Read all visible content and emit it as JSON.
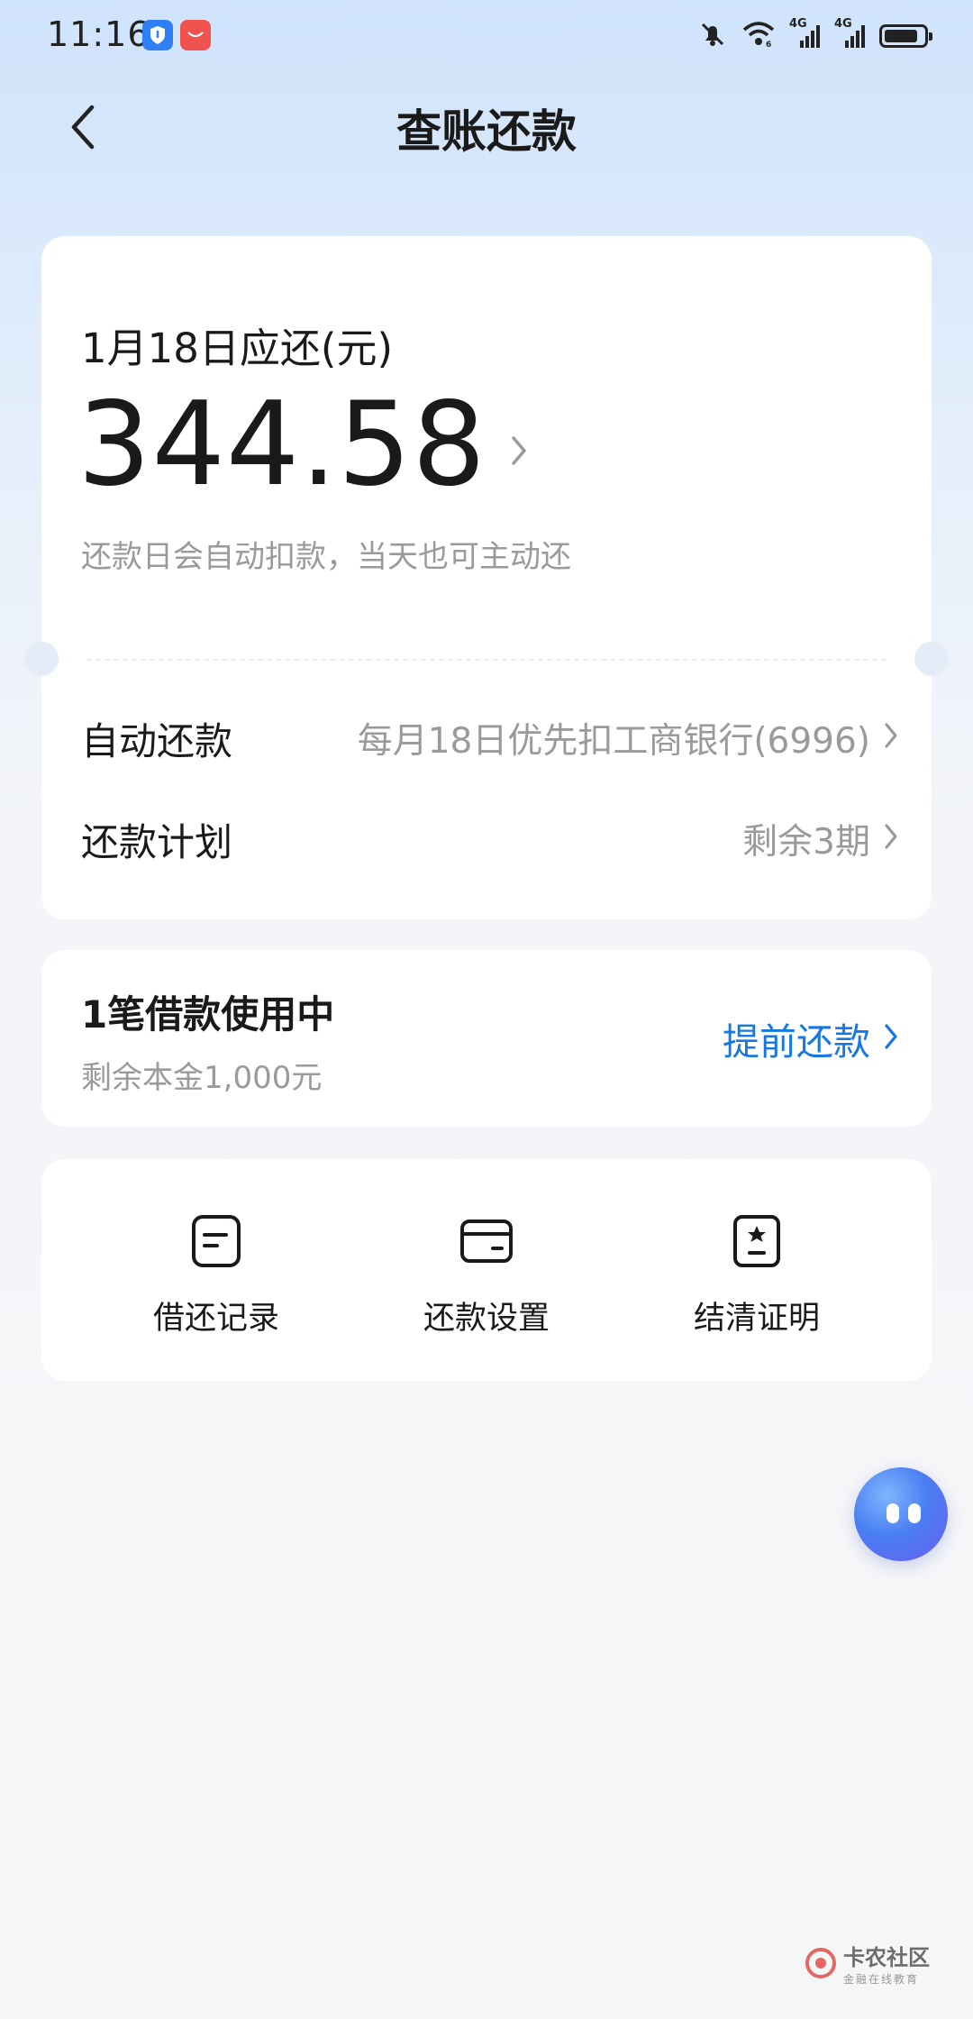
{
  "status_bar": {
    "time": "11:16",
    "network_1": "4G",
    "network_2": "4G",
    "battery_level": 0.85
  },
  "header": {
    "title": "查账还款"
  },
  "bill": {
    "due_label": "1月18日应还(元)",
    "amount": "344.58",
    "note": "还款日会自动扣款，当天也可主动还"
  },
  "auto_repay": {
    "label": "自动还款",
    "value": "每月18日优先扣工商银行(6996)"
  },
  "repay_plan": {
    "label": "还款计划",
    "value": "剩余3期"
  },
  "loan": {
    "title": "1笔借款使用中",
    "remaining": "剩余本金1,000元",
    "prepay_label": "提前还款"
  },
  "actions": [
    {
      "label": "借还记录",
      "icon": "record-icon"
    },
    {
      "label": "还款设置",
      "icon": "card-icon"
    },
    {
      "label": "结清证明",
      "icon": "certificate-icon"
    }
  ],
  "watermark": {
    "main": "卡农社区",
    "sub": "金融在线教育"
  },
  "colors": {
    "accent": "#1677e6",
    "muted": "#9a9a9a",
    "text": "#1a1a1a"
  }
}
